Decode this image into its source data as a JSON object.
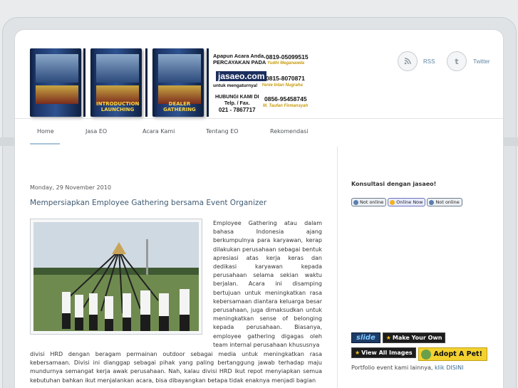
{
  "header": {
    "banner": {
      "dvd_labels": [
        "",
        "INTRODUCTION LAUNCHING",
        "DEALER GATHERING"
      ],
      "tagline_lines": [
        "Apapun Acara Anda,",
        "PERCAYAKAN PADA"
      ],
      "logo": "jasaeo.com",
      "subtagline": "untuk mengaturnya!",
      "hotline_lines": [
        "HUBUNGI KAMI DI",
        "Telp. / Fax.",
        "021 - 7867717"
      ],
      "contacts": [
        {
          "phone": "0819-05099515",
          "name": "Yudhi Meganawda"
        },
        {
          "phone": "0815-8070871",
          "name": "Yenie Intan Nugraha"
        },
        {
          "phone": "0856-95458745",
          "name": "M. Taufan Firmansyah"
        }
      ]
    },
    "social": [
      {
        "label": "RSS",
        "icon": "rss-icon"
      },
      {
        "label": "Twitter",
        "icon": "twitter-icon"
      }
    ]
  },
  "nav": {
    "items": [
      "Home",
      "Jasa EO",
      "Acara Kami",
      "Tentang EO",
      "Rekomendasi"
    ]
  },
  "post": {
    "date": "Monday, 29 November 2010",
    "title": "Mempersiapkan Employee Gathering bersama Event Organizer",
    "text_right": "Employee Gathering atau dalam bahasa Indonesia ajang berkumpulnya para karyawan, kerap dilakukan perusahaan sebagai bentuk apresiasi atas kerja keras dan dedikasi karyawan kepada perusahaan selama sekian waktu berjalan. Acara ini disamping bertujuan untuk meningkatkan rasa kebersamaan diantara keluarga besar perusahaan, juga dimaksudkan untuk meningkatkan sense of belonging kepada perusahaan. Biasanya, employee gathering digagas oleh team internal perusahaan khususnya",
    "text_bottom": "divisi HRD dengan beragam permainan outdoor sebagai media untuk meningkatkan rasa kebersamaan. Divisi ini dianggap sebagai pihak yang paling bertanggung jawab terhadap maju mundurnya semangat kerja awak perusahaan. Nah, kalau divisi HRD ikut repot menyiapkan semua kebutuhan bahkan ikut menjalankan acara, bisa dibayangkan betapa tidak enaknya menjadi bagian"
  },
  "sidebar": {
    "consult_title": "Konsultasi dengan jasaeo!",
    "statuses": [
      "Not online",
      "Online Now",
      "Not online"
    ],
    "slide_buttons": {
      "slide": "slide",
      "make_your_own": "Make Your Own",
      "view_all": "View All Images",
      "adopt": "Adopt A Pet!"
    },
    "portfolio_text": "Portfolio event kami lainnya,",
    "portfolio_link": "klik DISINI"
  }
}
